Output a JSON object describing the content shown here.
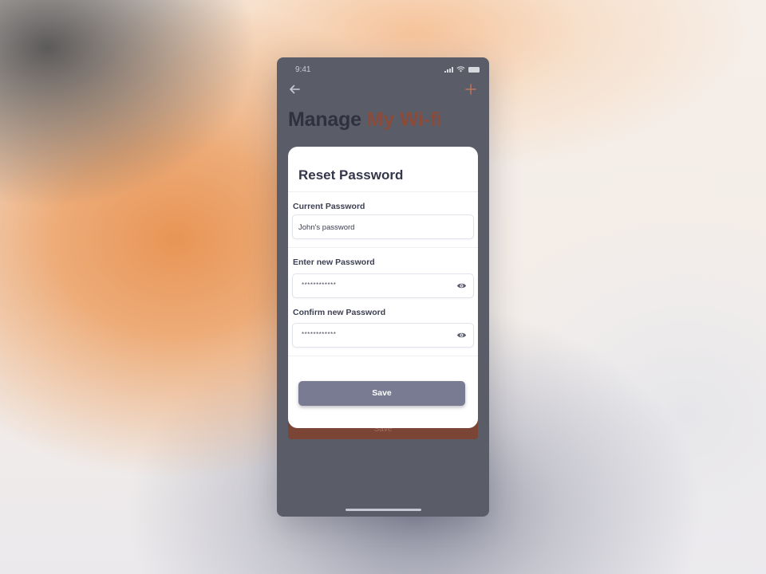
{
  "status_bar": {
    "time": "9:41"
  },
  "header": {
    "title_part1": "Manage",
    "title_part2": "My Wi-fi",
    "accent_color": "#8a4b3a"
  },
  "background_button": {
    "label": "Save"
  },
  "modal": {
    "title": "Reset Password",
    "fields": [
      {
        "label": "Current Password",
        "value": "John's password"
      },
      {
        "label": "Enter new Password",
        "value": "************",
        "icon": "eye-icon"
      },
      {
        "label": "Confirm new Password",
        "value": "************",
        "icon": "eye-icon"
      }
    ],
    "save_label": "Save",
    "save_color": "#787b91"
  }
}
